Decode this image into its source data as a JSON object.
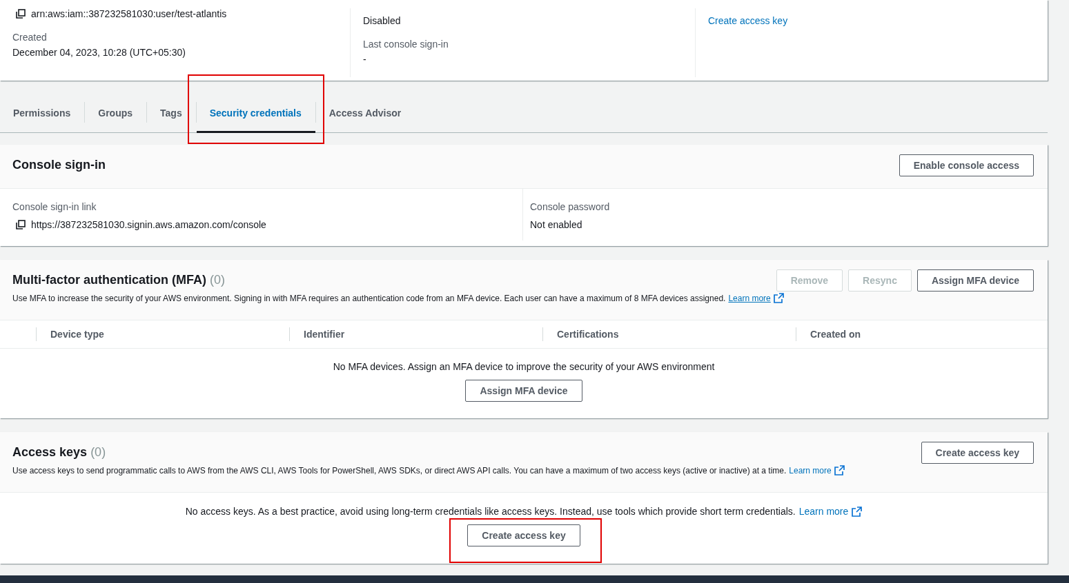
{
  "summary": {
    "columns": [
      {
        "fields": [
          {
            "kind": "copy",
            "value": "arn:aws:iam::387232581030:user/test-atlantis"
          },
          {
            "kind": "text",
            "label": "Created",
            "value": "December 04, 2023, 10:28 (UTC+05:30)"
          }
        ]
      },
      {
        "fields": [
          {
            "kind": "text",
            "value": "Disabled"
          },
          {
            "kind": "text",
            "label": "Last console sign-in",
            "value": "-"
          }
        ]
      },
      {
        "fields": [
          {
            "kind": "link",
            "value": "Create access key"
          }
        ]
      }
    ]
  },
  "tabs": [
    {
      "label": "Permissions",
      "selected": false,
      "highlighted": false
    },
    {
      "label": "Groups",
      "selected": false,
      "highlighted": false
    },
    {
      "label": "Tags",
      "selected": false,
      "highlighted": false
    },
    {
      "label": "Security credentials",
      "selected": true,
      "highlighted": true
    },
    {
      "label": "Access Advisor",
      "selected": false,
      "highlighted": false
    }
  ],
  "console_signin": {
    "title": "Console sign-in",
    "button": "Enable console access",
    "fields": [
      {
        "kind": "copy",
        "label": "Console sign-in link",
        "value": "https://387232581030.signin.aws.amazon.com/console"
      },
      {
        "kind": "text",
        "label": "Console password",
        "value": "Not enabled"
      }
    ]
  },
  "mfa": {
    "title": "Multi-factor authentication (MFA)",
    "count": "(0)",
    "description": "Use MFA to increase the security of your AWS environment. Signing in with MFA requires an authentication code from an MFA device. Each user can have a maximum of 8 MFA devices assigned.",
    "learn_more": "Learn more",
    "buttons": [
      {
        "label": "Remove",
        "disabled": true
      },
      {
        "label": "Resync",
        "disabled": true
      },
      {
        "label": "Assign MFA device",
        "disabled": false
      }
    ],
    "columns": [
      "Device type",
      "Identifier",
      "Certifications",
      "Created on"
    ],
    "empty_text": "No MFA devices. Assign an MFA device to improve the security of your AWS environment",
    "empty_button": {
      "label": "Assign MFA device"
    }
  },
  "access_keys": {
    "title": "Access keys",
    "count": "(0)",
    "description": "Use access keys to send programmatic calls to AWS from the AWS CLI, AWS Tools for PowerShell, AWS SDKs, or direct AWS API calls. You can have a maximum of two access keys (active or inactive) at a time.",
    "learn_more": "Learn more",
    "button": "Create access key",
    "empty_text": "No access keys. As a best practice, avoid using long-term credentials like access keys. Instead, use tools which provide short term credentials.",
    "empty_learn_more": "Learn more",
    "empty_button": {
      "label": "Create access key",
      "highlighted": true
    }
  }
}
